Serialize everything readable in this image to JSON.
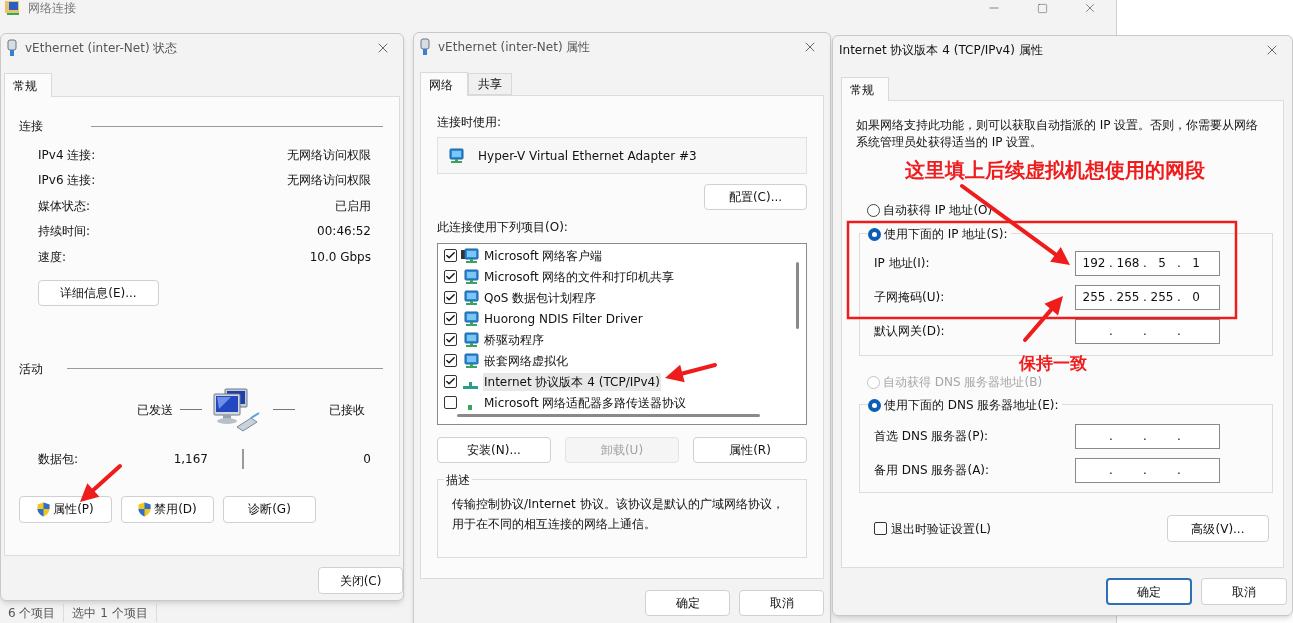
{
  "explorer": {
    "title": "网络连接",
    "status_bar": [
      "6 个项目",
      "选中 1 个项目"
    ]
  },
  "status_dialog": {
    "title": "vEthernet (inter-Net) 状态",
    "tabs": [
      {
        "label": "常规",
        "selected": true
      }
    ],
    "connection": {
      "heading": "连接",
      "rows": [
        {
          "label": "IPv4 连接:",
          "value": "无网络访问权限"
        },
        {
          "label": "IPv6 连接:",
          "value": "无网络访问权限"
        },
        {
          "label": "媒体状态:",
          "value": "已启用"
        },
        {
          "label": "持续时间:",
          "value": "00:46:52"
        },
        {
          "label": "速度:",
          "value": "10.0 Gbps"
        }
      ]
    },
    "details_button": "详细信息(E)...",
    "activity": {
      "heading": "活动",
      "sent_label": "已发送",
      "received_label": "已接收",
      "packets_label": "数据包:",
      "packets_sent": "1,167",
      "packets_received": "0"
    },
    "buttons": [
      {
        "label": "属性(P)",
        "shield": true
      },
      {
        "label": "禁用(D)",
        "shield": true
      },
      {
        "label": "诊断(G)",
        "shield": false
      }
    ],
    "close_button": "关闭(C)"
  },
  "properties_dialog": {
    "title": "vEthernet (inter-Net) 属性",
    "tabs": [
      {
        "label": "网络",
        "selected": true
      },
      {
        "label": "共享",
        "selected": false
      }
    ],
    "connect_using_label": "连接时使用:",
    "adapter": "Hyper-V Virtual Ethernet Adapter #3",
    "configure_button": "配置(C)...",
    "items_label": "此连接使用下列项目(O):",
    "items": [
      {
        "label": "Microsoft 网络客户端",
        "checked": true,
        "selected": false,
        "kind": "client"
      },
      {
        "label": "Microsoft 网络的文件和打印机共享",
        "checked": true,
        "selected": false,
        "kind": "service"
      },
      {
        "label": "QoS 数据包计划程序",
        "checked": true,
        "selected": false,
        "kind": "service"
      },
      {
        "label": "Huorong NDIS Filter Driver",
        "checked": true,
        "selected": false,
        "kind": "service"
      },
      {
        "label": "桥驱动程序",
        "checked": true,
        "selected": false,
        "kind": "service"
      },
      {
        "label": "嵌套网络虚拟化",
        "checked": true,
        "selected": false,
        "kind": "service"
      },
      {
        "label": "Internet 协议版本 4 (TCP/IPv4)",
        "checked": true,
        "selected": true,
        "kind": "protocol"
      },
      {
        "label": "Microsoft 网络适配器多路传送器协议",
        "checked": false,
        "selected": false,
        "kind": "protocol_small"
      }
    ],
    "buttons": [
      {
        "label": "安装(N)...",
        "disabled": false
      },
      {
        "label": "卸载(U)",
        "disabled": true
      },
      {
        "label": "属性(R)",
        "disabled": false
      }
    ],
    "description": {
      "heading": "描述",
      "text": "传输控制协议/Internet 协议。该协议是默认的广域网络协议，用于在不同的相互连接的网络上通信。"
    },
    "footer_buttons": [
      {
        "label": "确定",
        "default": false
      },
      {
        "label": "取消",
        "default": false
      }
    ]
  },
  "ipv4_dialog": {
    "title": "Internet 协议版本 4 (TCP/IPv4) 属性",
    "tabs": [
      {
        "label": "常规",
        "selected": true
      }
    ],
    "intro": "如果网络支持此功能，则可以获取自动指派的 IP 设置。否则，你需要从网络系统管理员处获得适当的 IP 设置。",
    "ip_modes": [
      {
        "label": "自动获得 IP 地址(O)",
        "selected": false,
        "disabled": false
      },
      {
        "label": "使用下面的 IP 地址(S):",
        "selected": true,
        "disabled": false
      }
    ],
    "ip_fields": [
      {
        "label": "IP 地址(I):",
        "octets": [
          "192",
          "168",
          "5",
          "1"
        ],
        "separators": [
          ".",
          ".",
          "."
        ]
      },
      {
        "label": "子网掩码(U):",
        "octets": [
          "255",
          "255",
          "255",
          "0"
        ],
        "separators": [
          ".",
          ".",
          "."
        ]
      },
      {
        "label": "默认网关(D):",
        "separators": [
          ".",
          ".",
          "."
        ]
      }
    ],
    "dns_modes": [
      {
        "label": "自动获得 DNS 服务器地址(B)",
        "selected": false,
        "disabled": true
      },
      {
        "label": "使用下面的 DNS 服务器地址(E):",
        "selected": true,
        "disabled": false
      }
    ],
    "dns_fields": [
      {
        "label": "首选 DNS 服务器(P):",
        "separators": [
          ".",
          ".",
          "."
        ]
      },
      {
        "label": "备用 DNS 服务器(A):",
        "separators": [
          ".",
          ".",
          "."
        ]
      }
    ],
    "validate_checkbox": {
      "label": "退出时验证设置(L)",
      "checked": false
    },
    "advanced_button": "高级(V)...",
    "footer_buttons": [
      {
        "label": "确定",
        "default": true
      },
      {
        "label": "取消",
        "default": false
      }
    ]
  },
  "annotations": [
    {
      "text": "这里填上后续虚拟机想使用的网段"
    },
    {
      "text": "保持一致"
    }
  ]
}
